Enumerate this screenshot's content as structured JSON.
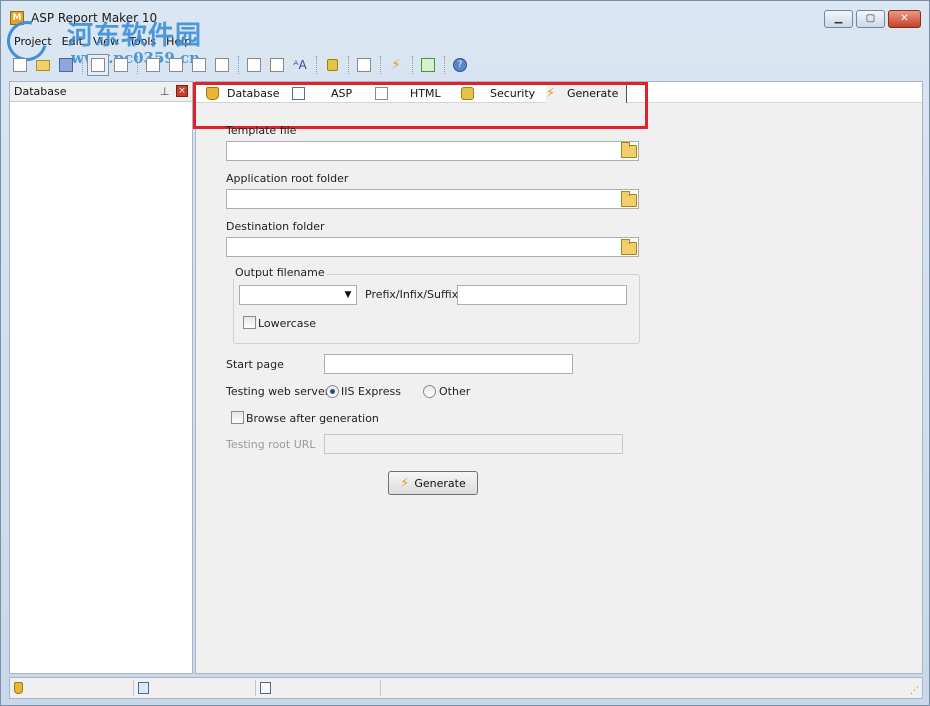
{
  "window": {
    "title": "ASP Report Maker 10",
    "minimize_label": "▁",
    "maximize_label": "▢",
    "close_label": "✕"
  },
  "watermark": {
    "logo_text": "河东软件园",
    "url_text": "www.pc0359.cn"
  },
  "menu": {
    "items": [
      "Project",
      "Edit",
      "View",
      "Tools",
      "Help"
    ]
  },
  "left_panel": {
    "title": "Database",
    "pin_glyph": "⊥",
    "close_glyph": "×"
  },
  "tabs": [
    {
      "label": "Database",
      "icon": "database-icon"
    },
    {
      "label": "ASP",
      "icon": "asp-page-icon"
    },
    {
      "label": "HTML",
      "icon": "html-page-icon"
    },
    {
      "label": "Security",
      "icon": "lock-icon"
    },
    {
      "label": "Generate",
      "icon": "lightning-icon"
    }
  ],
  "highlight_color": "#e0202a",
  "form": {
    "template_file_label": "Template file",
    "template_file_value": "",
    "app_root_label": "Application root folder",
    "app_root_value": "",
    "dest_folder_label": "Destination folder",
    "dest_folder_value": "",
    "output_filename_group": "Output filename",
    "output_filename_selected": "",
    "prefix_label": "Prefix/Infix/Suffix",
    "prefix_value": "",
    "lowercase_label": "Lowercase",
    "start_page_label": "Start page",
    "start_page_value": "",
    "testing_server_label": "Testing web server",
    "iis_express_label": "IIS Express",
    "other_label": "Other",
    "browse_after_label": "Browse after generation",
    "testing_root_label": "Testing root URL",
    "testing_root_value": "",
    "generate_button": "Generate"
  },
  "status": {
    "grip": "⋰"
  }
}
